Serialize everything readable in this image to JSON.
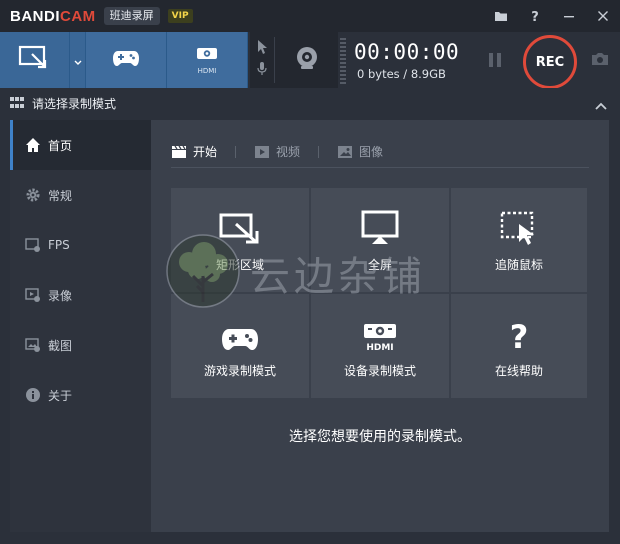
{
  "titlebar": {
    "logo_main": "BANDI",
    "logo_accent": "CAM",
    "edition": "班迪录屏",
    "vip": "VIP",
    "icons": [
      "folder-icon",
      "help-icon",
      "minimize-icon",
      "close-icon"
    ]
  },
  "toolbar": {
    "modes": [
      {
        "name": "screen-rectangle-mode",
        "icon": "rectangle-select-icon"
      },
      {
        "name": "game-mode",
        "icon": "gamepad-icon"
      },
      {
        "name": "device-mode",
        "icon": "hdmi-icon",
        "sub": "HDMI"
      }
    ],
    "timer": "00:00:00",
    "size": "0 bytes / 8.9GB",
    "rec_label": "REC"
  },
  "section": {
    "title": "请选择录制模式"
  },
  "sidebar": {
    "items": [
      {
        "label": "首页",
        "icon": "home-icon",
        "active": true
      },
      {
        "label": "常规",
        "icon": "gear-icon",
        "active": false
      },
      {
        "label": "FPS",
        "icon": "fps-gear-icon",
        "active": false
      },
      {
        "label": "录像",
        "icon": "video-gear-icon",
        "active": false
      },
      {
        "label": "截图",
        "icon": "image-gear-icon",
        "active": false
      },
      {
        "label": "关于",
        "icon": "info-icon",
        "active": false
      }
    ]
  },
  "main": {
    "tabs": [
      {
        "label": "开始",
        "icon": "clapper-icon",
        "active": true
      },
      {
        "label": "视频",
        "icon": "play-icon",
        "active": false
      },
      {
        "label": "图像",
        "icon": "image-icon",
        "active": false
      }
    ],
    "modes": [
      {
        "label": "矩形区域",
        "icon": "rectangle-select-icon"
      },
      {
        "label": "全屏",
        "icon": "monitor-icon"
      },
      {
        "label": "追随鼠标",
        "icon": "follow-mouse-icon"
      },
      {
        "label": "游戏录制模式",
        "icon": "gamepad-icon"
      },
      {
        "label": "设备录制模式",
        "icon": "hdmi-icon"
      },
      {
        "label": "在线帮助",
        "icon": "question-icon"
      }
    ],
    "hint": "选择您想要使用的录制模式。"
  },
  "watermark": {
    "text": "云边杂铺"
  },
  "colors": {
    "accent_red": "#e04a3a",
    "toolbar_blue": "#3f6c9d",
    "active_bar": "#3f82c9"
  }
}
